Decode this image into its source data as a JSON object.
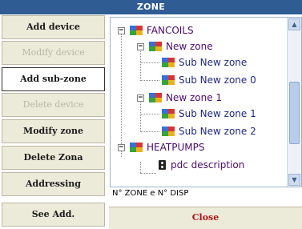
{
  "title": "ZONE",
  "buttons": [
    {
      "label": "Add device",
      "state": "normal"
    },
    {
      "label": "Modify device",
      "state": "disabled"
    },
    {
      "label": "Add sub-zone",
      "state": "active"
    },
    {
      "label": "Delete device",
      "state": "disabled"
    },
    {
      "label": "Modify zone",
      "state": "normal"
    },
    {
      "label": "Delete Zona",
      "state": "normal"
    },
    {
      "label": "Addressing",
      "state": "normal"
    },
    {
      "label": "See Add.",
      "state": "normal"
    }
  ],
  "tree": {
    "fancoils": "FANCOILS",
    "new_zone": "New zone",
    "sub_new_zone": "Sub New zone",
    "sub_new_zone_0": "Sub New zone 0",
    "new_zone_1": "New zone 1",
    "sub_new_zone_1": "Sub New zone 1",
    "sub_new_zone_2": "Sub New zone 2",
    "heatpumps": "HEATPUMPS",
    "pdc_description": "pdc description",
    "toggle_expanded": "−"
  },
  "scroll": {
    "up": "▲",
    "down": "▼"
  },
  "footer_label": "N° ZONE e N° DISP",
  "close_label": "Close",
  "colors": {
    "title_bar": "#2f5d93",
    "button_bg": "#ecead9",
    "close_text": "#b01515",
    "tree_purple": "#4b0a6e",
    "tree_navy": "#1f2a86"
  }
}
